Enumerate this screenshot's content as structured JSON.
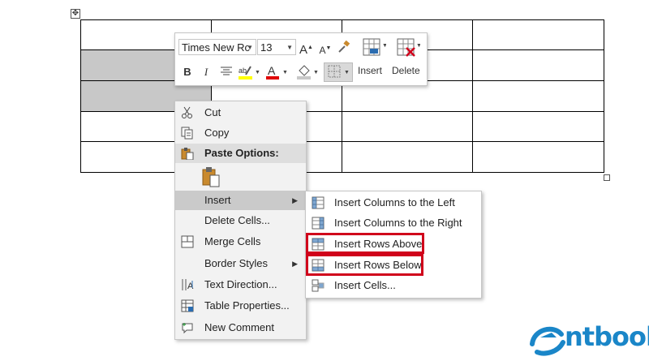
{
  "mini_toolbar": {
    "font_name": "Times New Rc",
    "font_size": "13",
    "insert_label": "Insert",
    "delete_label": "Delete",
    "grow_font": "A",
    "shrink_font": "A",
    "bold": "B",
    "italic": "I",
    "font_color_letter": "A"
  },
  "context_menu": {
    "items": [
      {
        "label": "Cut",
        "icon": "scissors-icon"
      },
      {
        "label": "Copy",
        "icon": "copy-icon"
      },
      {
        "label": "Paste Options:",
        "icon": "paste-icon"
      },
      {
        "label": "Insert",
        "icon": ""
      },
      {
        "label": "Delete Cells...",
        "icon": ""
      },
      {
        "label": "Merge Cells",
        "icon": "merge-cells-icon"
      },
      {
        "label": "Border Styles",
        "icon": ""
      },
      {
        "label": "Text Direction...",
        "icon": "text-direction-icon"
      },
      {
        "label": "Table Properties...",
        "icon": "table-properties-icon"
      },
      {
        "label": "New Comment",
        "icon": "new-comment-icon"
      }
    ]
  },
  "insert_submenu": {
    "items": [
      {
        "label": "Insert Columns to the Left"
      },
      {
        "label": "Insert Columns to the Right"
      },
      {
        "label": "Insert Rows Above"
      },
      {
        "label": "Insert Rows Below"
      },
      {
        "label": "Insert Cells..."
      }
    ]
  },
  "logo": {
    "text": "ntbook"
  },
  "colors": {
    "highlight_red": "#d0021b",
    "logo_blue": "#1a86c8",
    "selected_cell": "#c8c8c8"
  }
}
